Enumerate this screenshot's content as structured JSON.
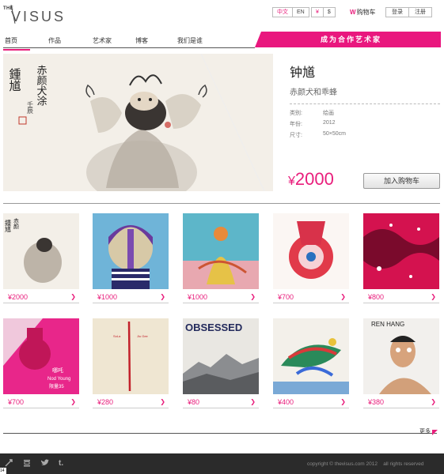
{
  "logo": {
    "small": "THE",
    "word": "VISUS"
  },
  "lang": {
    "zh": "中文",
    "en": "EN"
  },
  "currency": {
    "cny": "¥",
    "usd": "$"
  },
  "cart": {
    "icon": "w-icon",
    "label": "购物车"
  },
  "auth": {
    "login": "登录",
    "register": "注册"
  },
  "nav": {
    "items": [
      "首页",
      "作品",
      "艺术家",
      "博客",
      "我们是谁"
    ]
  },
  "banner": "成为合作艺术家",
  "featured": {
    "title": "钟馗",
    "artist": "赤颜犬和乖蜂",
    "meta": [
      {
        "k": "类别:",
        "v": "绘画"
      },
      {
        "k": "年份:",
        "v": "2012"
      },
      {
        "k": "尺寸:",
        "v": "50×50cm"
      }
    ],
    "price_symbol": "¥",
    "price": "2000",
    "add_to_cart": "加入购物车",
    "calligraphy": [
      "赤颜犬涂",
      "鍾馗",
      "壬辰"
    ]
  },
  "products": [
    {
      "price": "¥2000"
    },
    {
      "price": "¥1000"
    },
    {
      "price": "¥1000"
    },
    {
      "price": "¥700"
    },
    {
      "price": "¥800"
    },
    {
      "price": "¥700",
      "art_text": [
        "哪吒",
        "Nod Young",
        "限量35"
      ]
    },
    {
      "price": "¥280",
      "art_text": [
        "SoLa",
        "Jiu Gee"
      ]
    },
    {
      "price": "¥80",
      "art_text": [
        "OBSESSED"
      ]
    },
    {
      "price": "¥400"
    },
    {
      "price": "¥380",
      "art_text": [
        "REN HANG"
      ]
    }
  ],
  "more": "更多",
  "footer": {
    "icons": [
      "share-icon",
      "douban-icon",
      "twitter-icon",
      "tumblr-icon"
    ],
    "copyright": "copyright © thevisus.com 2012",
    "rights": "all rights reserved",
    "page_number": "14"
  },
  "colors": {
    "accent": "#e91e7c",
    "footer_bg": "#2b2b2b"
  }
}
